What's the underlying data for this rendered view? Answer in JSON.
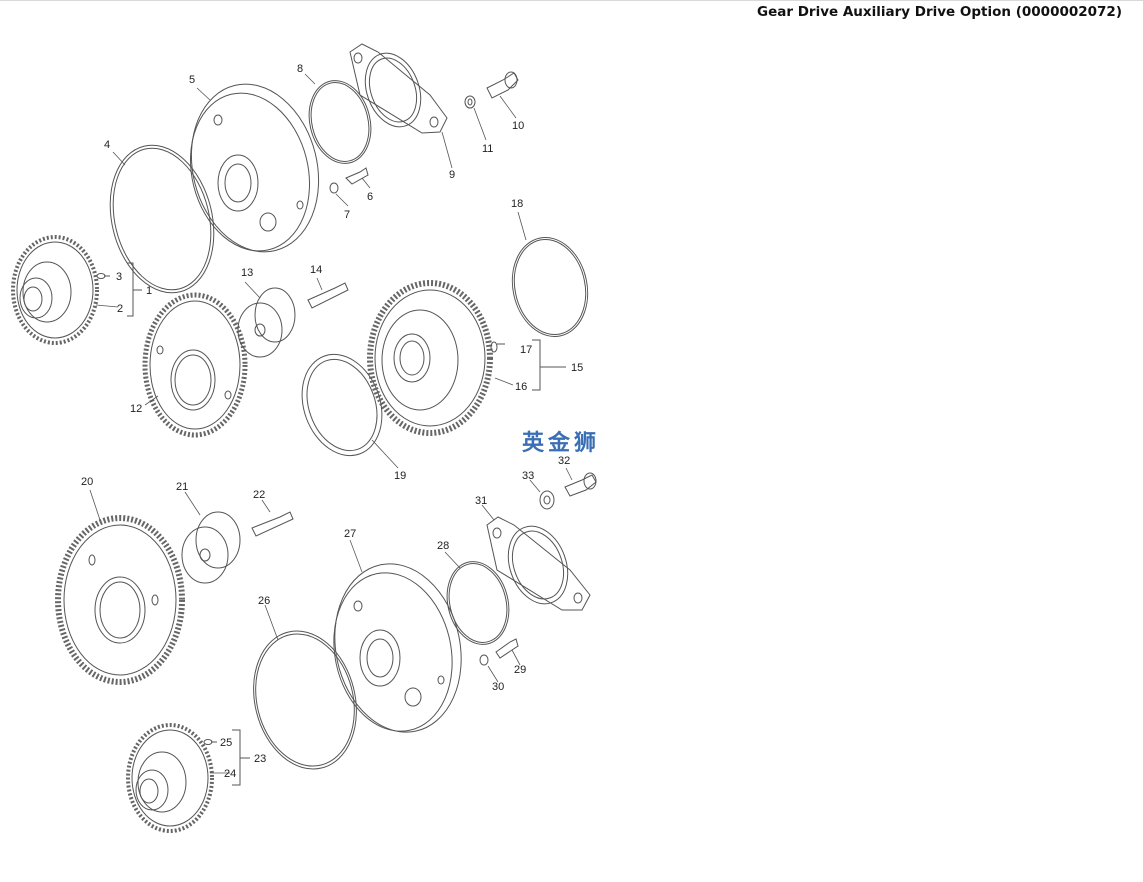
{
  "title": "Gear Drive Auxiliary Drive Option (0000002072)",
  "watermark": "英金狮",
  "callouts": [
    "1",
    "2",
    "3",
    "4",
    "5",
    "6",
    "7",
    "8",
    "9",
    "10",
    "11",
    "12",
    "13",
    "14",
    "15",
    "16",
    "17",
    "18",
    "19",
    "20",
    "21",
    "22",
    "23",
    "24",
    "25",
    "26",
    "27",
    "28",
    "29",
    "30",
    "31",
    "32",
    "33"
  ],
  "colors": {
    "line": "#555555",
    "label": "#222222",
    "watermark": "#3b6fb5"
  }
}
